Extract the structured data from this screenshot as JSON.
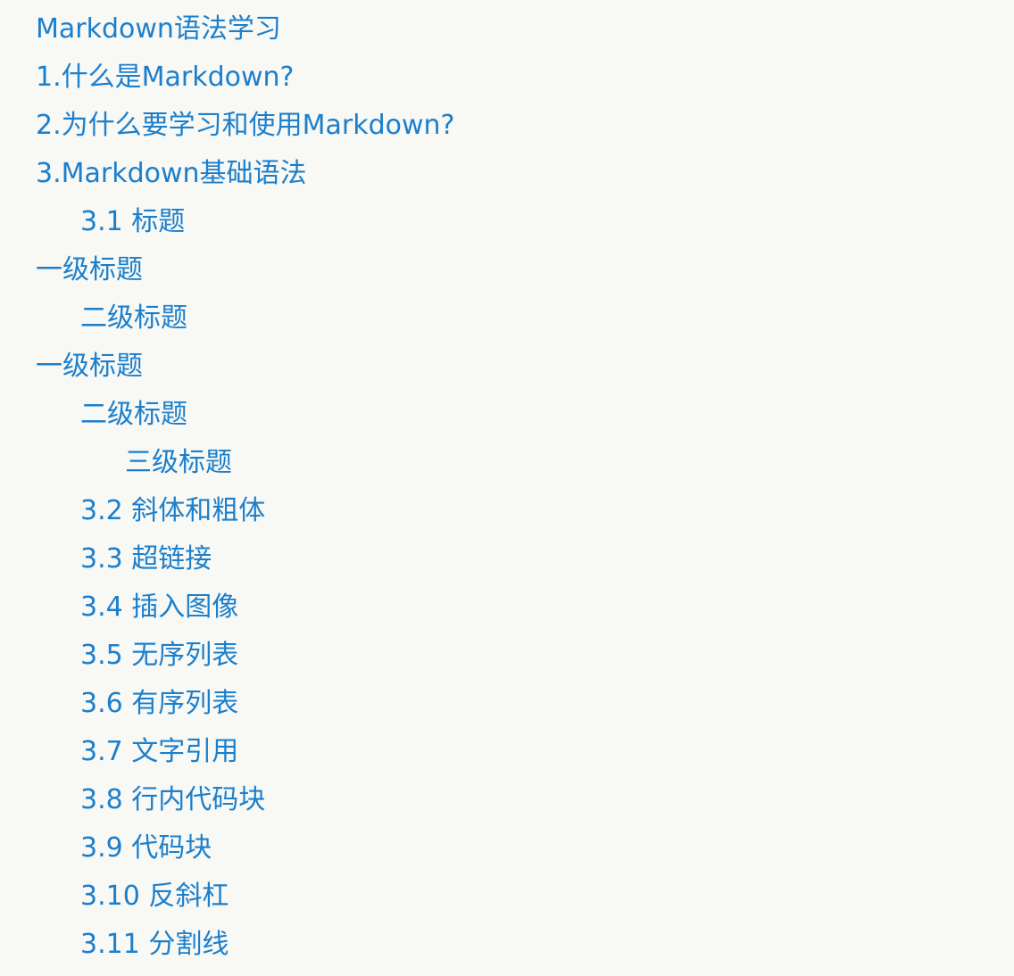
{
  "toc": {
    "items": [
      {
        "label": "Markdown语法学习",
        "level": 1
      },
      {
        "label": "1.什么是Markdown?",
        "level": 1
      },
      {
        "label": "2.为什么要学习和使用Markdown?",
        "level": 1
      },
      {
        "label": "3.Markdown基础语法",
        "level": 1
      },
      {
        "label": "3.1 标题",
        "level": 2
      },
      {
        "label": "一级标题",
        "level": 1
      },
      {
        "label": "二级标题",
        "level": 2
      },
      {
        "label": "一级标题",
        "level": 1
      },
      {
        "label": "二级标题",
        "level": 2
      },
      {
        "label": "三级标题",
        "level": 3
      },
      {
        "label": "3.2 斜体和粗体",
        "level": 2
      },
      {
        "label": "3.3 超链接",
        "level": 2
      },
      {
        "label": "3.4 插入图像",
        "level": 2
      },
      {
        "label": "3.5 无序列表",
        "level": 2
      },
      {
        "label": "3.6 有序列表",
        "level": 2
      },
      {
        "label": "3.7 文字引用",
        "level": 2
      },
      {
        "label": "3.8 行内代码块",
        "level": 2
      },
      {
        "label": "3.9 代码块",
        "level": 2
      },
      {
        "label": "3.10 反斜杠",
        "level": 2
      },
      {
        "label": "3.11 分割线",
        "level": 2
      }
    ]
  },
  "colors": {
    "link": "#1b7fcc",
    "background": "#f8f8f5"
  }
}
